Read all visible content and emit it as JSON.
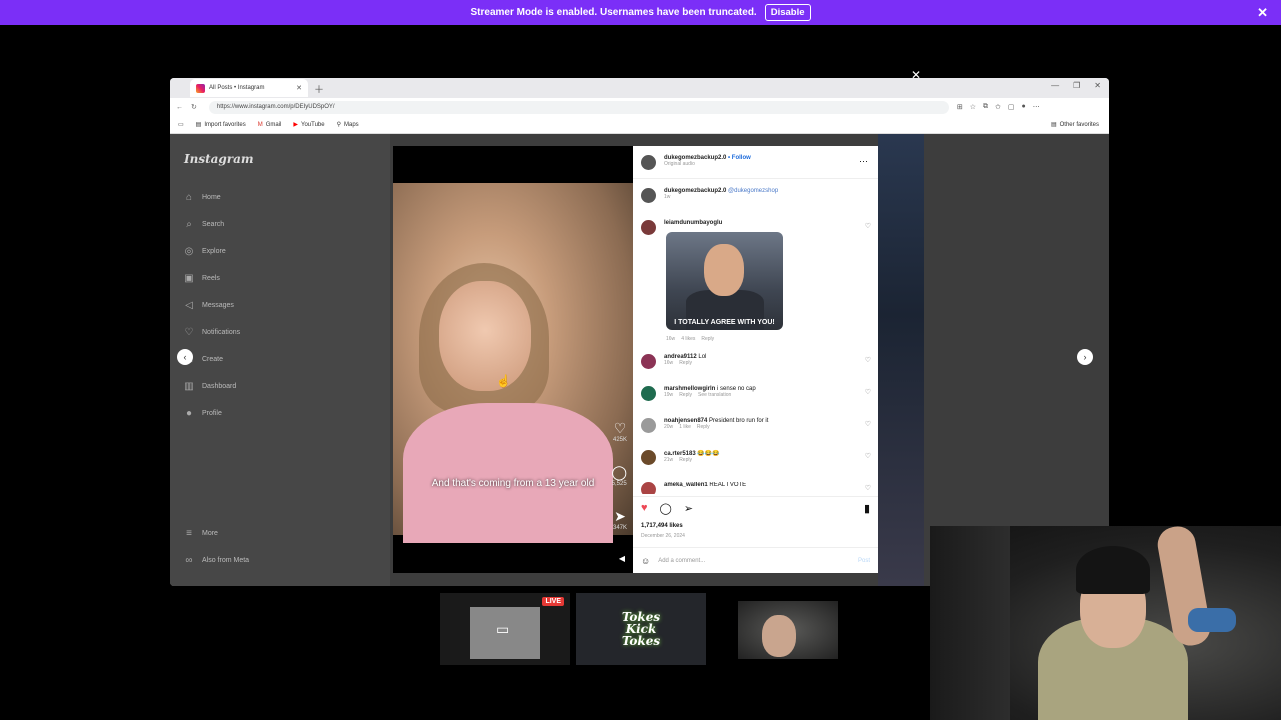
{
  "banner": {
    "message": "Streamer Mode is enabled. Usernames have been truncated.",
    "button": "Disable"
  },
  "browser": {
    "tab_title": "All Posts • Instagram",
    "url": "https://www.instagram.com/p/DEIyUDSpOY/",
    "bookmarks": [
      "Import favorites",
      "Gmail",
      "YouTube",
      "Maps"
    ],
    "other_favorites": "Other favorites"
  },
  "instagram": {
    "logo": "Instagram",
    "nav": [
      "Home",
      "Search",
      "Explore",
      "Reels",
      "Messages",
      "Notifications",
      "Create",
      "Dashboard",
      "Profile"
    ],
    "more": "More",
    "also_from_meta": "Also from Meta",
    "video": {
      "caption": "And that's coming from a 13 year old",
      "likes_count": "425K",
      "comments_count": "5,525",
      "shares_count": "347K"
    },
    "post": {
      "username": "dukegomezbackup2.0",
      "follow": "• Follow",
      "audio": "Original audio",
      "author_username": "dukegomezbackup2.0",
      "author_mention": "@dukegomezshop",
      "author_time": "1w",
      "comments": [
        {
          "user": "leiamdunumbayoglu",
          "text": "",
          "time": "16w",
          "likes": "4 likes",
          "reply": "Reply",
          "gif_text": "I TOTALLY AGREE WITH YOU!"
        },
        {
          "user": "andrea9112",
          "text": "Lol",
          "time": "16w",
          "reply": "Reply"
        },
        {
          "user": "marshmellowgirln",
          "text": "i sense no cap",
          "time": "19w",
          "reply": "Reply",
          "extra": "See translation"
        },
        {
          "user": "noahjensen874",
          "text": "President bro run for it",
          "time": "20w",
          "likes": "1 like",
          "reply": "Reply"
        },
        {
          "user": "ca.rter5183",
          "text": "😂😂😂",
          "time": "21w",
          "reply": "Reply"
        },
        {
          "user": "ameka_wallen1",
          "text": "REAL I VOTE",
          "time": "",
          "reply": ""
        }
      ],
      "likes": "1,717,494 likes",
      "date": "December 26, 2024",
      "add_comment_placeholder": "Add a comment...",
      "post_button": "Post"
    }
  },
  "overlay": {
    "live_badge": "LIVE",
    "tokes_logo": "Tokes Kick Tokes"
  }
}
